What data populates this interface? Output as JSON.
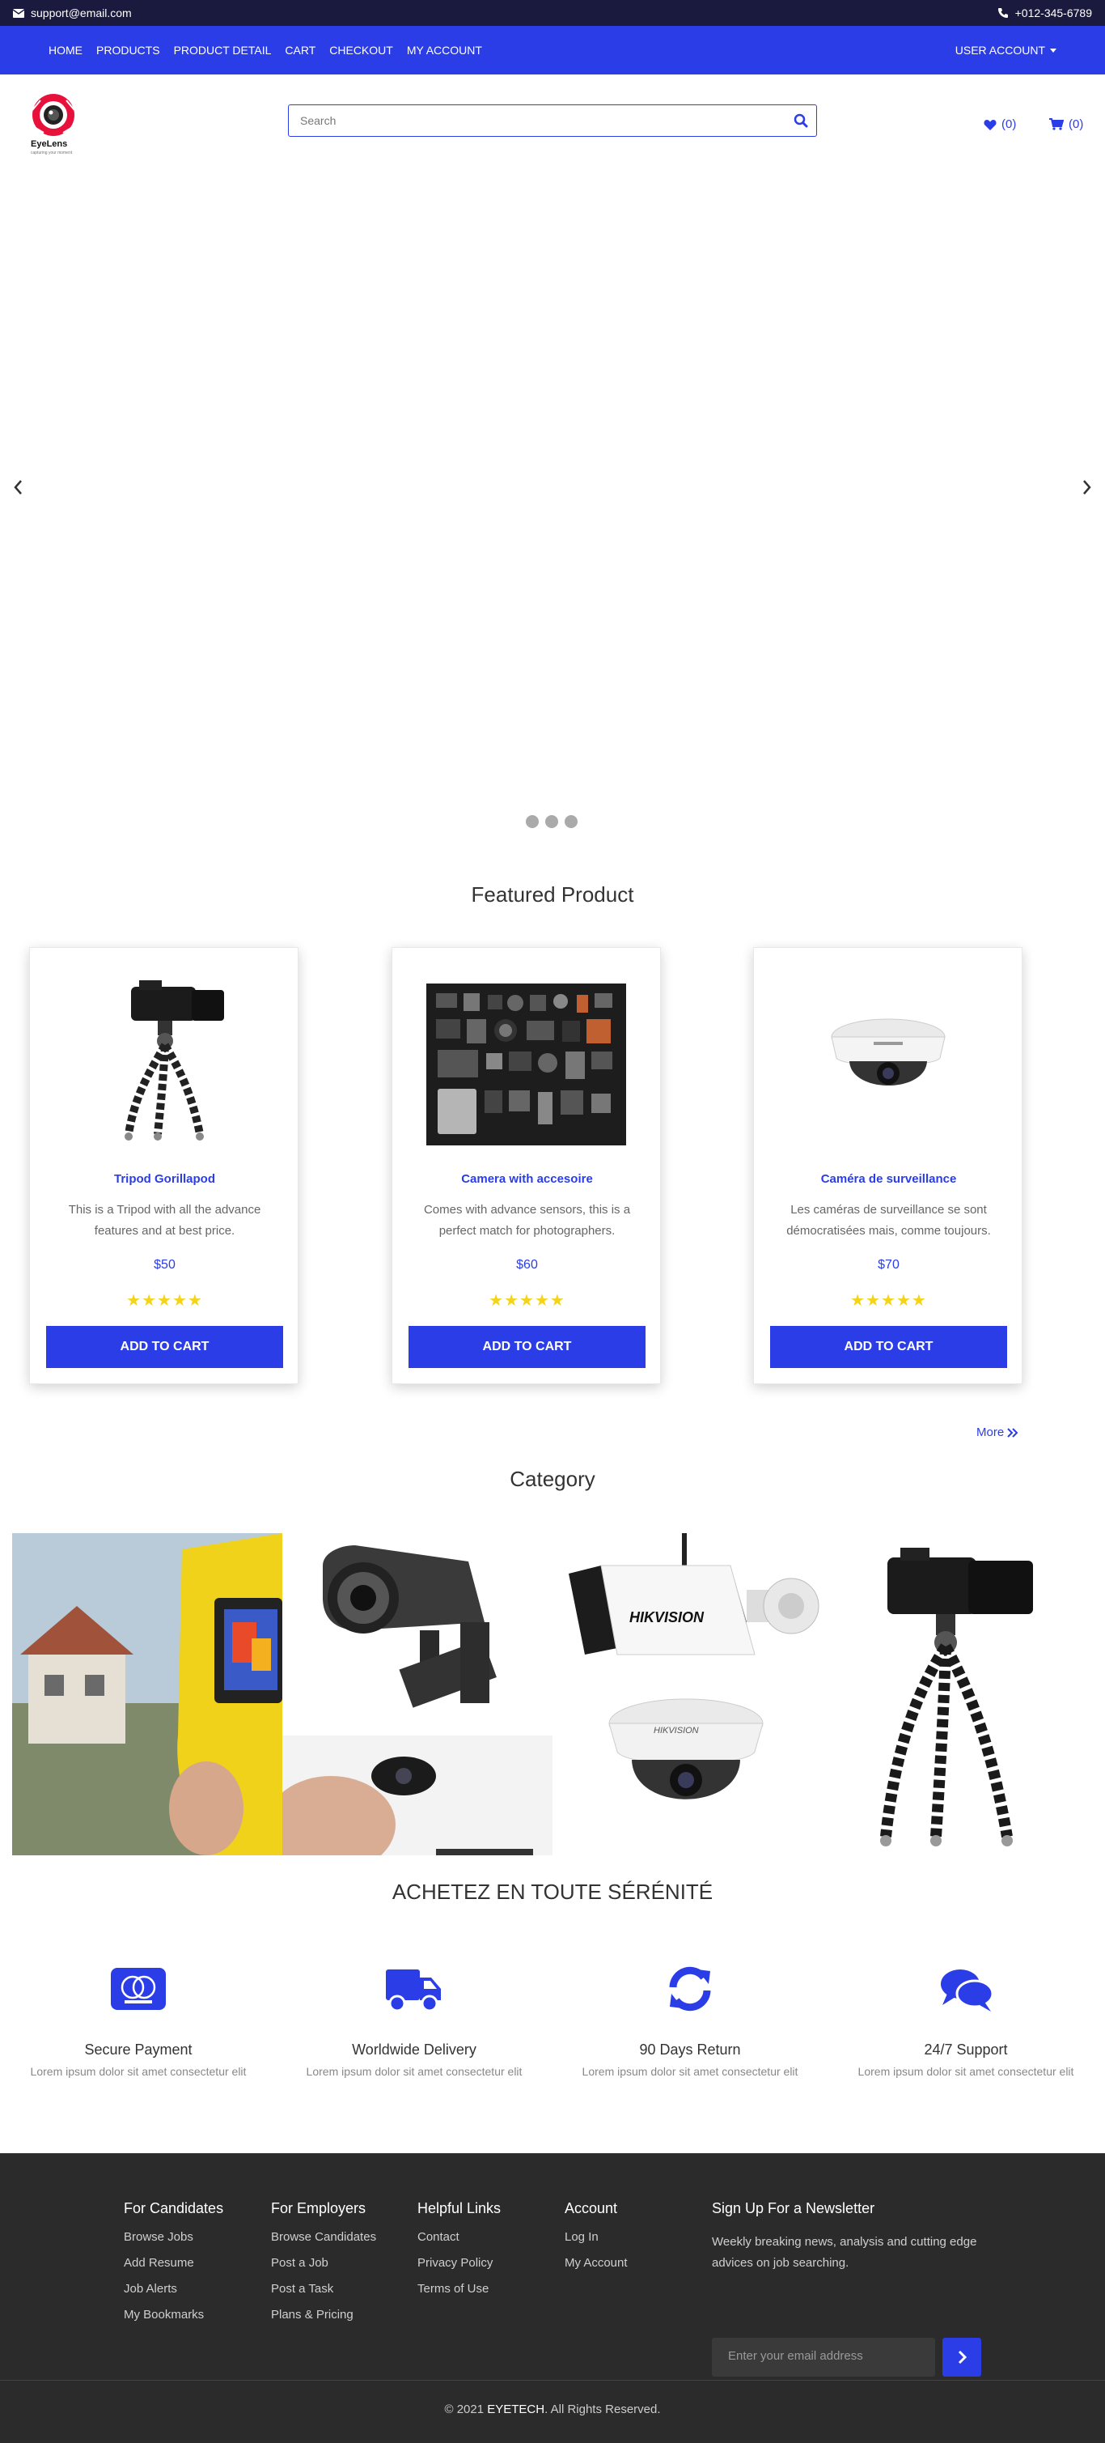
{
  "topbar": {
    "email": "support@email.com",
    "phone": "+012-345-6789"
  },
  "nav": {
    "links": [
      "HOME",
      "PRODUCTS",
      "PRODUCT DETAIL",
      "CART",
      "CHECKOUT",
      "MY ACCOUNT"
    ],
    "user_account": "USER ACCOUNT"
  },
  "brand": {
    "name": "EyeLens",
    "tagline": "capturing your moment"
  },
  "search": {
    "placeholder": "Search"
  },
  "header_counts": {
    "wishlist": "(0)",
    "cart": "(0)"
  },
  "featured": {
    "title": "Featured Product",
    "products": [
      {
        "name": "Tripod Gorillapod",
        "desc": "This is a Tripod with all the advance features and at best price.",
        "price": "$50",
        "stars": "★★★★★",
        "button": "ADD TO CART"
      },
      {
        "name": "Camera with accesoire",
        "desc": "Comes with advance sensors, this is a perfect match for photographers.",
        "price": "$60",
        "stars": "★★★★★",
        "button": "ADD TO CART"
      },
      {
        "name": "Caméra de surveillance",
        "desc": "Les caméras de surveillance se sont démocratisées mais, comme toujours.",
        "price": "$70",
        "stars": "★★★★★",
        "button": "ADD TO CART"
      }
    ],
    "more": "More"
  },
  "category": {
    "title": "Category"
  },
  "features": {
    "title": "ACHETEZ EN TOUTE SÉRÉNITÉ",
    "items": [
      {
        "title": "Secure Payment",
        "desc": "Lorem ipsum dolor sit amet consectetur elit",
        "icon": "mastercard-icon"
      },
      {
        "title": "Worldwide Delivery",
        "desc": "Lorem ipsum dolor sit amet consectetur elit",
        "icon": "truck-icon"
      },
      {
        "title": "90 Days Return",
        "desc": "Lorem ipsum dolor sit amet consectetur elit",
        "icon": "refresh-icon"
      },
      {
        "title": "24/7 Support",
        "desc": "Lorem ipsum dolor sit amet consectetur elit",
        "icon": "chat-icon"
      }
    ]
  },
  "footer": {
    "columns": [
      {
        "title": "For Candidates",
        "links": [
          "Browse Jobs",
          "Add Resume",
          "Job Alerts",
          "My Bookmarks"
        ]
      },
      {
        "title": "For Employers",
        "links": [
          "Browse Candidates",
          "Post a Job",
          "Post a Task",
          "Plans & Pricing"
        ]
      },
      {
        "title": "Helpful Links",
        "links": [
          "Contact",
          "Privacy Policy",
          "Terms of Use"
        ]
      },
      {
        "title": "Account",
        "links": [
          "Log In",
          "My Account"
        ]
      }
    ],
    "newsletter": {
      "title": "Sign Up For a Newsletter",
      "text": "Weekly breaking news, analysis and cutting edge advices on job searching.",
      "placeholder": "Enter your email address"
    },
    "copyright_prefix": "© 2021",
    "copyright_brand": "EYETECH",
    "copyright_suffix": ". All Rights Reserved."
  },
  "colors": {
    "primary": "#2b3de6",
    "topbar": "#1a1a3e",
    "footer": "#2b2b2b",
    "star": "#f5d316"
  }
}
